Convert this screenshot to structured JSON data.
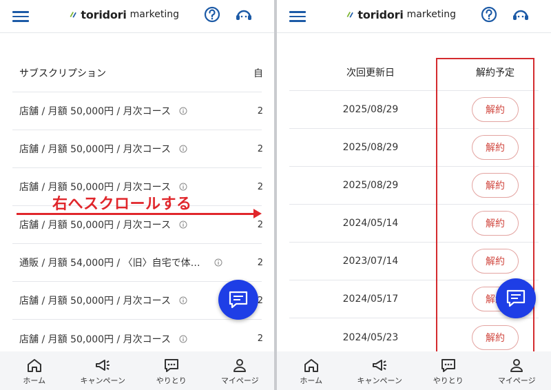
{
  "app": {
    "logo_bold": "toridori",
    "logo_light": "marketing"
  },
  "left_panel": {
    "column_header": "サブスクリプション",
    "cut_header_char": "自",
    "rows": [
      {
        "text": "店舗 / 月額 50,000円 / 月次コース",
        "cut": "2"
      },
      {
        "text": "店舗 / 月額 50,000円 / 月次コース",
        "cut": "2"
      },
      {
        "text": "店舗 / 月額 50,000円 / 月次コース",
        "cut": "2"
      },
      {
        "text": "店舗 / 月額 50,000円 / 月次コース",
        "cut": "2"
      },
      {
        "text": "通販 / 月額 54,000円 / 〈旧〉自宅で体…",
        "cut": "2"
      },
      {
        "text": "店舗 / 月額 50,000円 / 月次コース",
        "cut": "2"
      },
      {
        "text": "店舗 / 月額 50,000円 / 月次コース",
        "cut": "2"
      }
    ],
    "annotation": "右へスクロールする"
  },
  "right_panel": {
    "header_next_renewal": "次回更新日",
    "header_cancel_schedule": "解約予定",
    "rows": [
      {
        "date": "2025/08/29",
        "button": "解約"
      },
      {
        "date": "2025/08/29",
        "button": "解約"
      },
      {
        "date": "2025/08/29",
        "button": "解約"
      },
      {
        "date": "2024/05/14",
        "button": "解約"
      },
      {
        "date": "2023/07/14",
        "button": "解約"
      },
      {
        "date": "2024/05/17",
        "button": "解約"
      },
      {
        "date": "2024/05/23",
        "button": "解約"
      }
    ]
  },
  "nav": {
    "home": "ホーム",
    "campaign": "キャンペーン",
    "messages": "やりとり",
    "mypage": "マイページ"
  },
  "colors": {
    "accent_blue": "#1c5aa6",
    "fab_blue": "#1e3ee6",
    "annotation_red": "#e0262b",
    "cancel_red": "#d0463e"
  },
  "icons": [
    "menu-icon",
    "help-icon",
    "support-icon",
    "info-icon",
    "chat-icon",
    "home-icon",
    "megaphone-icon",
    "message-icon",
    "person-icon"
  ]
}
